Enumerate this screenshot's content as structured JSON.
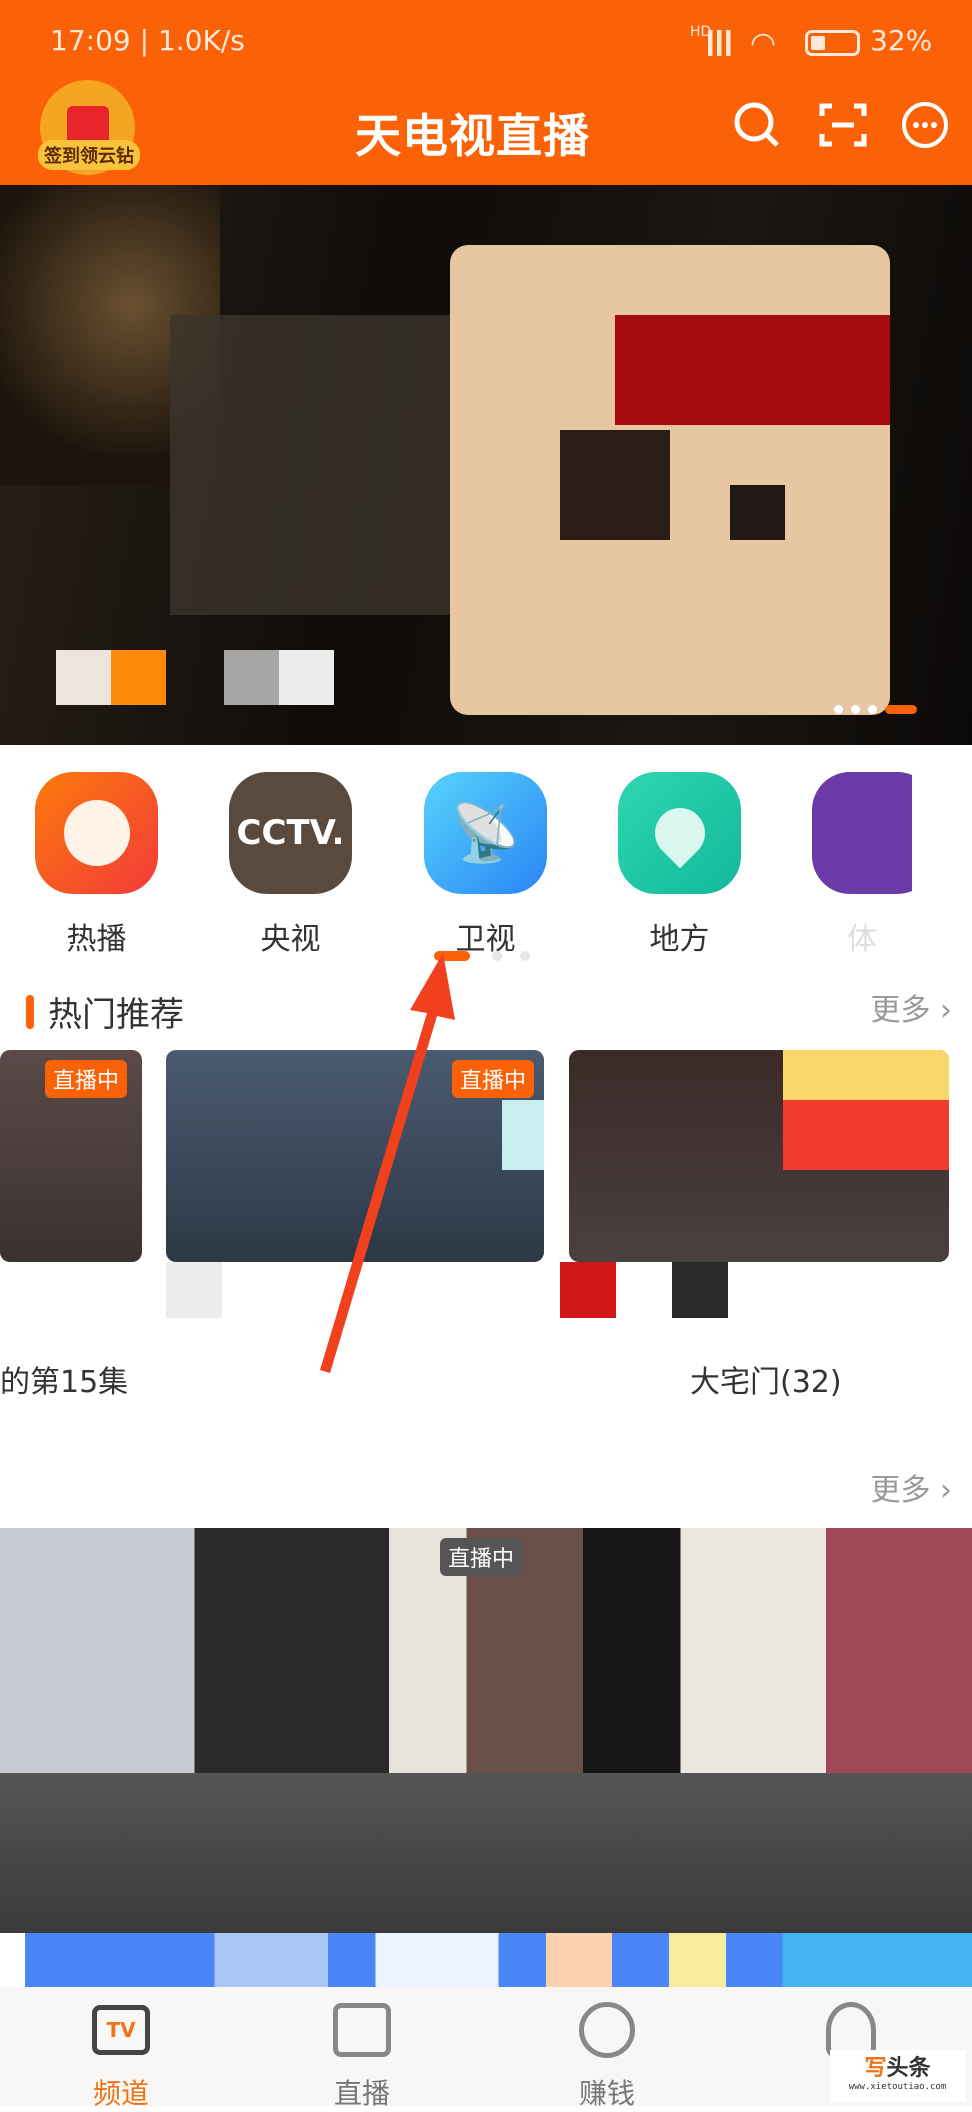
{
  "status_bar": {
    "time": "17:09",
    "speed": "1.0K/s",
    "network": "HD",
    "battery": "32%"
  },
  "header": {
    "checkin_label": "签到领云钻",
    "title": "天电视直播",
    "icons": [
      "search-icon",
      "scan-icon",
      "message-icon"
    ]
  },
  "banner": {
    "slides": 4,
    "active": 3
  },
  "categories": [
    {
      "label": "热播",
      "color": "#fb6a12",
      "icon": "flame-chart-icon"
    },
    {
      "label": "央视",
      "color": "#5a4a3d",
      "icon": "cctv-logo",
      "logo_text": "CCTV."
    },
    {
      "label": "卫视",
      "color": "#3aa8f6",
      "icon": "satellite-dish-icon"
    },
    {
      "label": "地方",
      "color": "#21c4a4",
      "icon": "location-pin-icon"
    },
    {
      "label": "体",
      "color": "#6a3aa8",
      "icon": "sports-icon"
    }
  ],
  "category_pager": {
    "pages": 3,
    "active": 1
  },
  "hot_section": {
    "title": "热门推荐",
    "more": "更多",
    "cards": [
      {
        "badge": "直播中",
        "title": "的第15集"
      },
      {
        "badge": "直播中",
        "title": ""
      },
      {
        "badge": "",
        "title": "大宅门(32)"
      }
    ]
  },
  "second_section": {
    "more": "更多",
    "cards": [
      {
        "badge": "直播中"
      }
    ]
  },
  "tabbar": {
    "items": [
      {
        "label": "频道",
        "active": true
      },
      {
        "label": "直播"
      },
      {
        "label": "赚钱"
      },
      {
        "label": ""
      }
    ]
  },
  "watermark": {
    "text": "写头条",
    "url": "www.xietoutiao.com"
  },
  "colors": {
    "brand": "#fb6208",
    "annotation_arrow": "#f0401e"
  }
}
